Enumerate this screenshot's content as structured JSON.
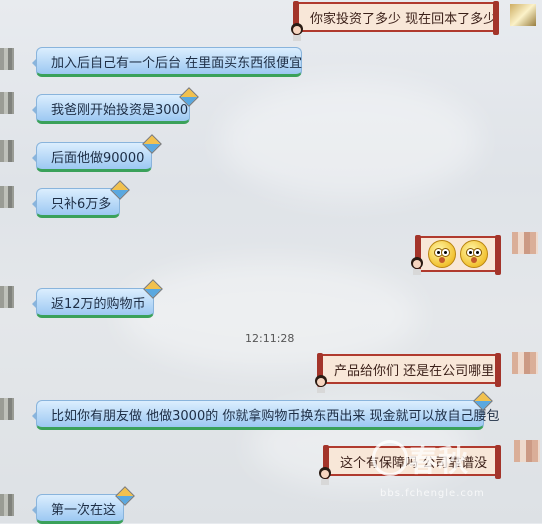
{
  "messages": {
    "right_1": "你家投资了多少  现在回本了多少",
    "left_1": "加入后自己有一个后台 在里面买东西很便宜",
    "left_2": "我爸刚开始投资是3000",
    "left_3": "后面他做90000",
    "left_4": "只补6万多",
    "left_5": "返12万的购物币",
    "right_3": "产品给你们  还是在公司哪里",
    "left_6": "比如你有朋友做 他做3000的 你就拿购物币换东西出来 现金就可以放自己腰包",
    "right_4": "这个有保障吗   公司靠谱没",
    "left_7": "第一次在这"
  },
  "timestamp": "12:11:28",
  "watermark": {
    "brand": "春秋",
    "url": "bbs.fchengle.com"
  },
  "icons": {
    "emoji": "surprised-face-icon",
    "sticker_left": "kite-icon",
    "sticker_right": "girl-avatar-icon"
  },
  "colors": {
    "left_bubble": "#9cc8f2",
    "left_underline": "#3aa15a",
    "right_border": "#b03a2e",
    "right_fill": "#f8e7d8"
  }
}
